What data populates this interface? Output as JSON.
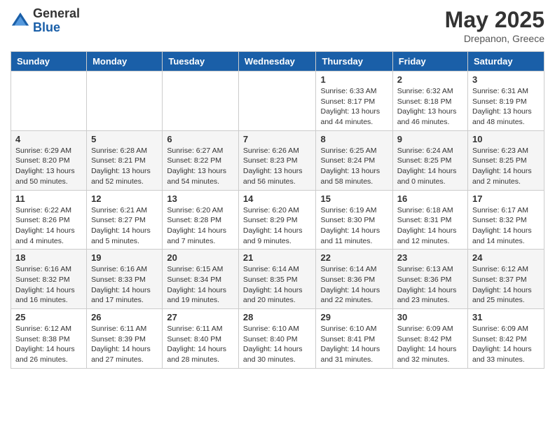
{
  "header": {
    "logo_general": "General",
    "logo_blue": "Blue",
    "month_year": "May 2025",
    "location": "Drepanon, Greece"
  },
  "days_of_week": [
    "Sunday",
    "Monday",
    "Tuesday",
    "Wednesday",
    "Thursday",
    "Friday",
    "Saturday"
  ],
  "weeks": [
    [
      {
        "day": "",
        "content": ""
      },
      {
        "day": "",
        "content": ""
      },
      {
        "day": "",
        "content": ""
      },
      {
        "day": "",
        "content": ""
      },
      {
        "day": "1",
        "content": "Sunrise: 6:33 AM\nSunset: 8:17 PM\nDaylight: 13 hours and 44 minutes."
      },
      {
        "day": "2",
        "content": "Sunrise: 6:32 AM\nSunset: 8:18 PM\nDaylight: 13 hours and 46 minutes."
      },
      {
        "day": "3",
        "content": "Sunrise: 6:31 AM\nSunset: 8:19 PM\nDaylight: 13 hours and 48 minutes."
      }
    ],
    [
      {
        "day": "4",
        "content": "Sunrise: 6:29 AM\nSunset: 8:20 PM\nDaylight: 13 hours and 50 minutes."
      },
      {
        "day": "5",
        "content": "Sunrise: 6:28 AM\nSunset: 8:21 PM\nDaylight: 13 hours and 52 minutes."
      },
      {
        "day": "6",
        "content": "Sunrise: 6:27 AM\nSunset: 8:22 PM\nDaylight: 13 hours and 54 minutes."
      },
      {
        "day": "7",
        "content": "Sunrise: 6:26 AM\nSunset: 8:23 PM\nDaylight: 13 hours and 56 minutes."
      },
      {
        "day": "8",
        "content": "Sunrise: 6:25 AM\nSunset: 8:24 PM\nDaylight: 13 hours and 58 minutes."
      },
      {
        "day": "9",
        "content": "Sunrise: 6:24 AM\nSunset: 8:25 PM\nDaylight: 14 hours and 0 minutes."
      },
      {
        "day": "10",
        "content": "Sunrise: 6:23 AM\nSunset: 8:25 PM\nDaylight: 14 hours and 2 minutes."
      }
    ],
    [
      {
        "day": "11",
        "content": "Sunrise: 6:22 AM\nSunset: 8:26 PM\nDaylight: 14 hours and 4 minutes."
      },
      {
        "day": "12",
        "content": "Sunrise: 6:21 AM\nSunset: 8:27 PM\nDaylight: 14 hours and 5 minutes."
      },
      {
        "day": "13",
        "content": "Sunrise: 6:20 AM\nSunset: 8:28 PM\nDaylight: 14 hours and 7 minutes."
      },
      {
        "day": "14",
        "content": "Sunrise: 6:20 AM\nSunset: 8:29 PM\nDaylight: 14 hours and 9 minutes."
      },
      {
        "day": "15",
        "content": "Sunrise: 6:19 AM\nSunset: 8:30 PM\nDaylight: 14 hours and 11 minutes."
      },
      {
        "day": "16",
        "content": "Sunrise: 6:18 AM\nSunset: 8:31 PM\nDaylight: 14 hours and 12 minutes."
      },
      {
        "day": "17",
        "content": "Sunrise: 6:17 AM\nSunset: 8:32 PM\nDaylight: 14 hours and 14 minutes."
      }
    ],
    [
      {
        "day": "18",
        "content": "Sunrise: 6:16 AM\nSunset: 8:32 PM\nDaylight: 14 hours and 16 minutes."
      },
      {
        "day": "19",
        "content": "Sunrise: 6:16 AM\nSunset: 8:33 PM\nDaylight: 14 hours and 17 minutes."
      },
      {
        "day": "20",
        "content": "Sunrise: 6:15 AM\nSunset: 8:34 PM\nDaylight: 14 hours and 19 minutes."
      },
      {
        "day": "21",
        "content": "Sunrise: 6:14 AM\nSunset: 8:35 PM\nDaylight: 14 hours and 20 minutes."
      },
      {
        "day": "22",
        "content": "Sunrise: 6:14 AM\nSunset: 8:36 PM\nDaylight: 14 hours and 22 minutes."
      },
      {
        "day": "23",
        "content": "Sunrise: 6:13 AM\nSunset: 8:36 PM\nDaylight: 14 hours and 23 minutes."
      },
      {
        "day": "24",
        "content": "Sunrise: 6:12 AM\nSunset: 8:37 PM\nDaylight: 14 hours and 25 minutes."
      }
    ],
    [
      {
        "day": "25",
        "content": "Sunrise: 6:12 AM\nSunset: 8:38 PM\nDaylight: 14 hours and 26 minutes."
      },
      {
        "day": "26",
        "content": "Sunrise: 6:11 AM\nSunset: 8:39 PM\nDaylight: 14 hours and 27 minutes."
      },
      {
        "day": "27",
        "content": "Sunrise: 6:11 AM\nSunset: 8:40 PM\nDaylight: 14 hours and 28 minutes."
      },
      {
        "day": "28",
        "content": "Sunrise: 6:10 AM\nSunset: 8:40 PM\nDaylight: 14 hours and 30 minutes."
      },
      {
        "day": "29",
        "content": "Sunrise: 6:10 AM\nSunset: 8:41 PM\nDaylight: 14 hours and 31 minutes."
      },
      {
        "day": "30",
        "content": "Sunrise: 6:09 AM\nSunset: 8:42 PM\nDaylight: 14 hours and 32 minutes."
      },
      {
        "day": "31",
        "content": "Sunrise: 6:09 AM\nSunset: 8:42 PM\nDaylight: 14 hours and 33 minutes."
      }
    ]
  ]
}
